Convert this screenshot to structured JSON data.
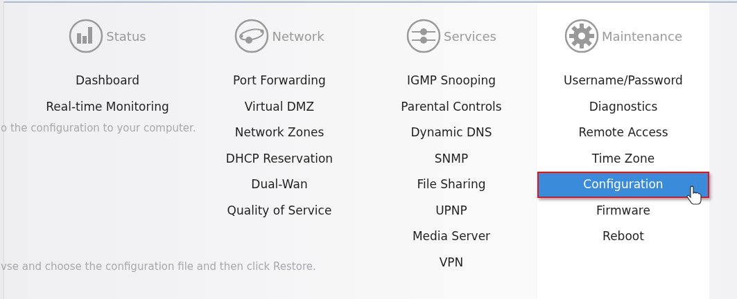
{
  "background_page": {
    "texts": [
      "o the configuration to your computer.",
      "vse and choose the configuration file and then click Restore."
    ]
  },
  "menu": {
    "columns": [
      {
        "title": "Status",
        "items": [
          {
            "label": "Dashboard",
            "selected": false
          },
          {
            "label": "Real-time Monitoring",
            "selected": false
          }
        ]
      },
      {
        "title": "Network",
        "items": [
          {
            "label": "Port Forwarding",
            "selected": false
          },
          {
            "label": "Virtual DMZ",
            "selected": false
          },
          {
            "label": "Network Zones",
            "selected": false
          },
          {
            "label": "DHCP Reservation",
            "selected": false
          },
          {
            "label": "Dual-Wan",
            "selected": false
          },
          {
            "label": "Quality of Service",
            "selected": false
          }
        ]
      },
      {
        "title": "Services",
        "items": [
          {
            "label": "IGMP Snooping",
            "selected": false
          },
          {
            "label": "Parental Controls",
            "selected": false
          },
          {
            "label": "Dynamic DNS",
            "selected": false
          },
          {
            "label": "SNMP",
            "selected": false
          },
          {
            "label": "File Sharing",
            "selected": false
          },
          {
            "label": "UPNP",
            "selected": false
          },
          {
            "label": "Media Server",
            "selected": false
          },
          {
            "label": "VPN",
            "selected": false
          }
        ]
      },
      {
        "title": "Maintenance",
        "active": true,
        "items": [
          {
            "label": "Username/Password",
            "selected": false
          },
          {
            "label": "Diagnostics",
            "selected": false
          },
          {
            "label": "Remote Access",
            "selected": false
          },
          {
            "label": "Time Zone",
            "selected": false
          },
          {
            "label": "Configuration",
            "selected": true
          },
          {
            "label": "Firmware",
            "selected": false
          },
          {
            "label": "Reboot",
            "selected": false
          }
        ]
      }
    ]
  }
}
